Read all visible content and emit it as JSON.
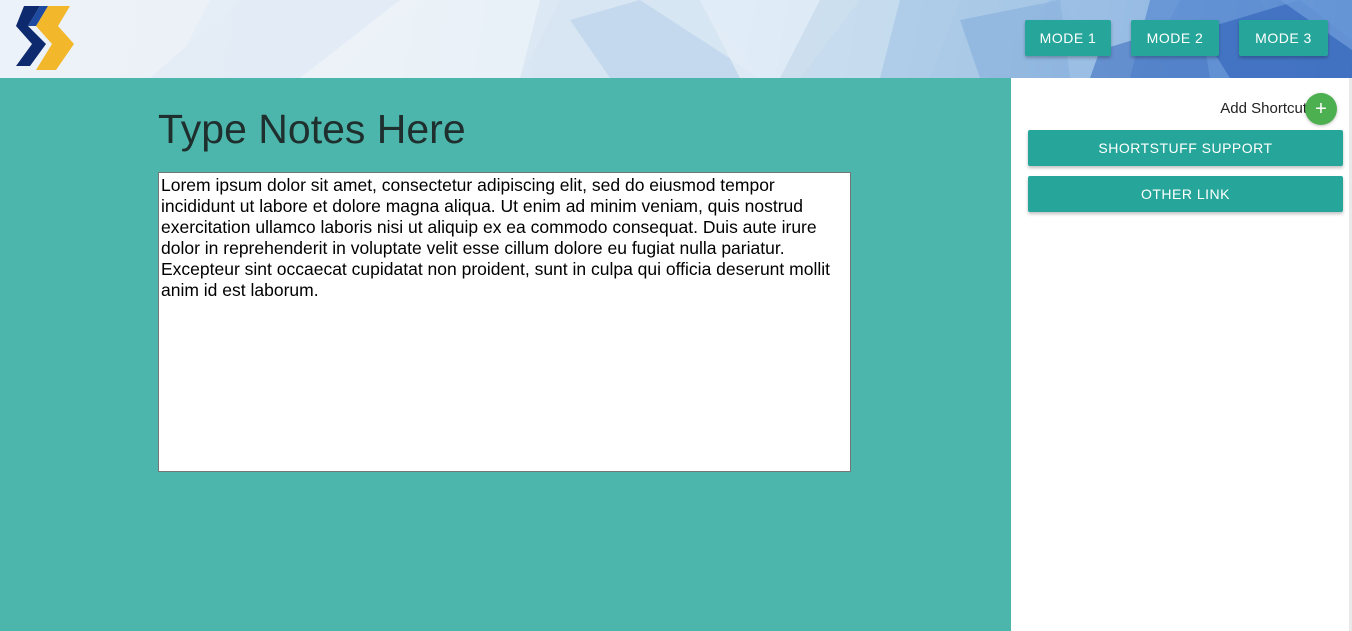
{
  "header": {
    "logo_icon": "shortstuff-logo-icon",
    "modes": [
      {
        "label": "MODE 1"
      },
      {
        "label": "MODE 2"
      },
      {
        "label": "MODE 3"
      }
    ]
  },
  "main": {
    "title": "Type Notes Here",
    "notes_value": "Lorem ipsum dolor sit amet, consectetur adipiscing elit, sed do eiusmod tempor incididunt ut labore et dolore magna aliqua. Ut enim ad minim veniam, quis nostrud exercitation ullamco laboris nisi ut aliquip ex ea commodo consequat. Duis aute irure dolor in reprehenderit in voluptate velit esse cillum dolore eu fugiat nulla pariatur. Excepteur sint occaecat cupidatat non proident, sunt in culpa qui officia deserunt mollit anim id est laborum."
  },
  "sidebar": {
    "add_shortcut_label": "Add Shortcut",
    "add_icon": "plus-icon",
    "add_symbol": "+",
    "links": [
      {
        "label": "SHORTSTUFF SUPPORT"
      },
      {
        "label": "OTHER LINK"
      }
    ]
  },
  "colors": {
    "accent": "#26a69a",
    "main_background": "#4db6ac",
    "add_button": "#4caf50"
  }
}
